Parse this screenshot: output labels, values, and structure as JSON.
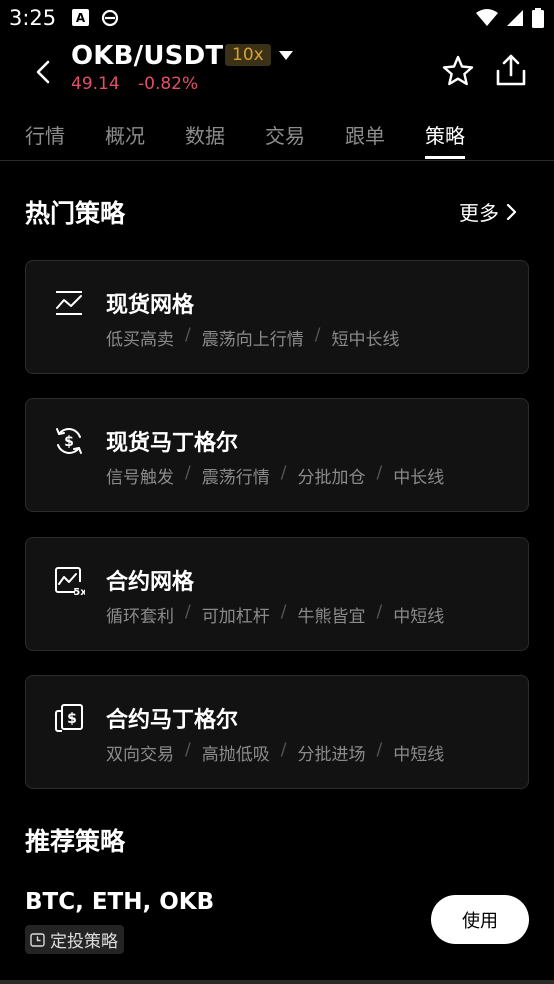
{
  "status_bar": {
    "time": "3:25",
    "notif_a": "A"
  },
  "header": {
    "pair": "OKB/USDT",
    "leverage": "10x",
    "price": "49.14",
    "change": "-0.82%"
  },
  "tabs": [
    "行情",
    "概况",
    "数据",
    "交易",
    "跟单",
    "策略"
  ],
  "active_tab": "策略",
  "hot": {
    "title": "热门策略",
    "more": "更多",
    "cards": [
      {
        "title": "现货网格",
        "tags": [
          "低买高卖",
          "震荡向上行情",
          "短中长线"
        ],
        "icon": "spot-grid-icon"
      },
      {
        "title": "现货马丁格尔",
        "tags": [
          "信号触发",
          "震荡行情",
          "分批加仓",
          "中长线"
        ],
        "icon": "spot-martingale-icon"
      },
      {
        "title": "合约网格",
        "tags": [
          "循环套利",
          "可加杠杆",
          "牛熊皆宜",
          "中短线"
        ],
        "icon": "futures-grid-icon"
      },
      {
        "title": "合约马丁格尔",
        "tags": [
          "双向交易",
          "高抛低吸",
          "分批进场",
          "中短线"
        ],
        "icon": "futures-martingale-icon"
      }
    ],
    "separator": "/",
    "badge_5x": "5x"
  },
  "recommended": {
    "title": "推荐策略",
    "coins": "BTC, ETH, OKB",
    "badge": "定投策略",
    "use_label": "使用"
  },
  "colors": {
    "accent_red": "#e14f68",
    "leverage_text": "#d8a230",
    "leverage_bg": "#3a3116"
  }
}
